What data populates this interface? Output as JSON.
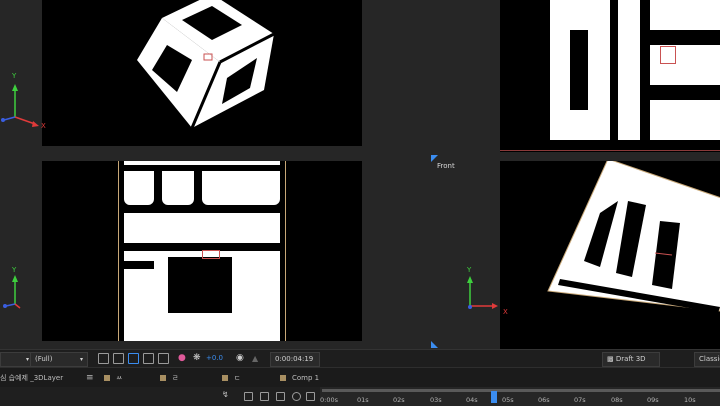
{
  "viewports": {
    "front_label": "Front",
    "axis_labels": {
      "x": "X",
      "y": "Y"
    }
  },
  "toolbar": {
    "resolution": "(Full)",
    "exposure": "+0.0",
    "timecode": "0:00:04:19",
    "renderer": "Draft 3D",
    "view_mode": "Classic"
  },
  "tabs": {
    "project_name": "심 습예제 _3DLayer",
    "items": [
      {
        "label": "ㅆ"
      },
      {
        "label": "ㄹ"
      },
      {
        "label": "ㄷ"
      },
      {
        "label": "Comp 1"
      }
    ]
  },
  "timeline": {
    "ticks": [
      "0:00s",
      "01s",
      "02s",
      "03s",
      "04s",
      "05s",
      "06s",
      "07s",
      "08s",
      "09s",
      "10s"
    ]
  },
  "colors": {
    "axis_x": "#e03a3a",
    "axis_y": "#3ecf3e",
    "axis_z": "#3a5ee0",
    "selection": "#c95252",
    "playhead": "#3b8df0",
    "layer_swatch": "#a88f62"
  }
}
